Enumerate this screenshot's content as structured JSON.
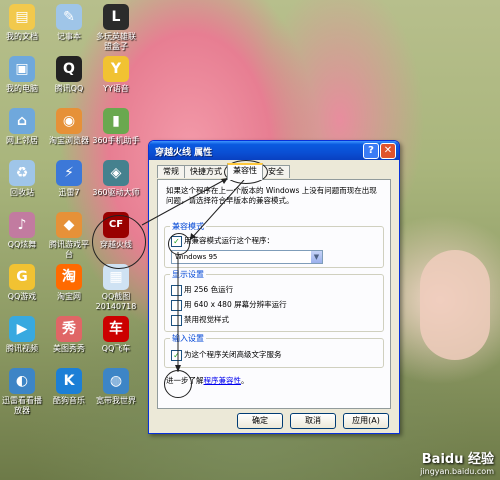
{
  "colors": {
    "titlebar": "#0a4fd4",
    "dialog_bg": "#ece9d8",
    "group_title": "#0046d5",
    "check": "#21a121"
  },
  "desktop": {
    "icons": [
      {
        "label": "我的文档",
        "icon": "folder-icon",
        "color": "#f2c94c",
        "glyph": "▤"
      },
      {
        "label": "记事本",
        "icon": "notepad-icon",
        "color": "#9fc5e8",
        "glyph": "✎"
      },
      {
        "label": "多玩英雄联\n盟盒子",
        "icon": "lol-box-icon",
        "color": "#2b2b2b",
        "glyph": "L"
      },
      {
        "label": "我的电脑",
        "icon": "computer-icon",
        "color": "#6fa8dc",
        "glyph": "▣"
      },
      {
        "label": "腾讯QQ",
        "icon": "qq-penguin-icon",
        "color": "#222",
        "glyph": "Q"
      },
      {
        "label": "YY语音",
        "icon": "yy-voice-icon",
        "color": "#f1c232",
        "glyph": "Y"
      },
      {
        "label": "网上邻居",
        "icon": "network-icon",
        "color": "#6fa8dc",
        "glyph": "⌂"
      },
      {
        "label": "淘宝浏览器",
        "icon": "taobao-browser-icon",
        "color": "#e69138",
        "glyph": "◉"
      },
      {
        "label": "360手机助手",
        "icon": "360-phone-icon",
        "color": "#6aa84f",
        "glyph": "▮"
      },
      {
        "label": "回收站",
        "icon": "recycle-bin-icon",
        "color": "#9fc5e8",
        "glyph": "♻"
      },
      {
        "label": "迅雷7",
        "icon": "thunder-icon",
        "color": "#3c78d8",
        "glyph": "⚡"
      },
      {
        "label": "360驱动大师",
        "icon": "360-driver-icon",
        "color": "#45818e",
        "glyph": "◈"
      },
      {
        "label": "QQ炫舞",
        "icon": "qq-dance-icon",
        "color": "#c27ba0",
        "glyph": "♪"
      },
      {
        "label": "腾讯游戏平\n台",
        "icon": "tencent-games-icon",
        "color": "#e69138",
        "glyph": "◆"
      },
      {
        "label": "穿越火线",
        "icon": "crossfire-icon",
        "color": "#990000",
        "glyph": "CF"
      },
      {
        "label": "QQ游戏",
        "icon": "qq-game-icon",
        "color": "#f1c232",
        "glyph": "G"
      },
      {
        "label": "淘宝网",
        "icon": "taobao-icon",
        "color": "#ff6a00",
        "glyph": "淘"
      },
      {
        "label": "QQ截图\n20140718",
        "icon": "screenshot-file-icon",
        "color": "#cfe2f3",
        "glyph": "▦"
      },
      {
        "label": "腾讯视频",
        "icon": "tencent-video-icon",
        "color": "#38a9e0",
        "glyph": "▶"
      },
      {
        "label": "美图秀秀",
        "icon": "meitu-icon",
        "color": "#e06666",
        "glyph": "秀"
      },
      {
        "label": "QQ飞车",
        "icon": "qq-speed-icon",
        "color": "#cc0000",
        "glyph": "车"
      },
      {
        "label": "迅雷看看播\n放器",
        "icon": "xunlei-player-icon",
        "color": "#3d85c6",
        "glyph": "◐"
      },
      {
        "label": "酷狗音乐",
        "icon": "kugou-icon",
        "color": "#1c7fd6",
        "glyph": "K"
      },
      {
        "label": "宽带我世界",
        "icon": "globe-icon",
        "color": "#3d85c6",
        "glyph": "◍"
      }
    ]
  },
  "dialog": {
    "title": "穿越火线 属性",
    "help_btn": "?",
    "close_btn": "✕",
    "tabs": [
      "常规",
      "快捷方式",
      "兼容性",
      "安全"
    ],
    "description": "如果这个程序在上一个版本的 Windows 上没有问题而现在出现问题，请选择符合早版本的兼容模式。",
    "compat_group": {
      "title": "兼容模式",
      "checkbox_label": "用兼容模式运行这个程序：",
      "checked": true,
      "select_value": "Windows 95"
    },
    "display_group": {
      "title": "显示设置",
      "options": [
        {
          "label": "用 256 色运行",
          "checked": false
        },
        {
          "label": "用 640 x 480 屏幕分辨率运行",
          "checked": false
        },
        {
          "label": "禁用视觉样式",
          "checked": false
        }
      ]
    },
    "input_group": {
      "title": "输入设置",
      "checkbox_label": "为这个程序关闭高级文字服务",
      "checked": true
    },
    "learn_more_prefix": "进一步了解",
    "learn_more_link": "程序兼容性",
    "learn_more_suffix": "。",
    "buttons": {
      "ok": "确定",
      "cancel": "取消",
      "apply": "应用(A)"
    }
  },
  "watermark": {
    "brand": "Baidu 经验",
    "url": "jingyan.baidu.com"
  }
}
